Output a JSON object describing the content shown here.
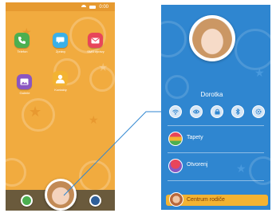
{
  "left_phone": {
    "status_time": "0:00",
    "app_labels": [
      "Telefon",
      "Zprávy",
      "SMS\nzprávy",
      "Galerie",
      "Kontakty"
    ],
    "dock": [
      "kontakty",
      "profil",
      "nastavení"
    ]
  },
  "right_phone": {
    "profile_name": "Dorotka",
    "quick_actions": [
      "wifi-icon",
      "eye-icon",
      "lock-icon",
      "bluetooth-icon",
      "settings-icon"
    ],
    "menu": [
      {
        "label": "Tapety"
      },
      {
        "label": "Otvorenj"
      }
    ],
    "center_bar_label": "Centrum rodiče"
  },
  "colors": {
    "left_bg": "#f1ab3f",
    "right_bg": "#2f86d0",
    "center_bar": "#f3b332",
    "callout": "#2f86d0"
  }
}
